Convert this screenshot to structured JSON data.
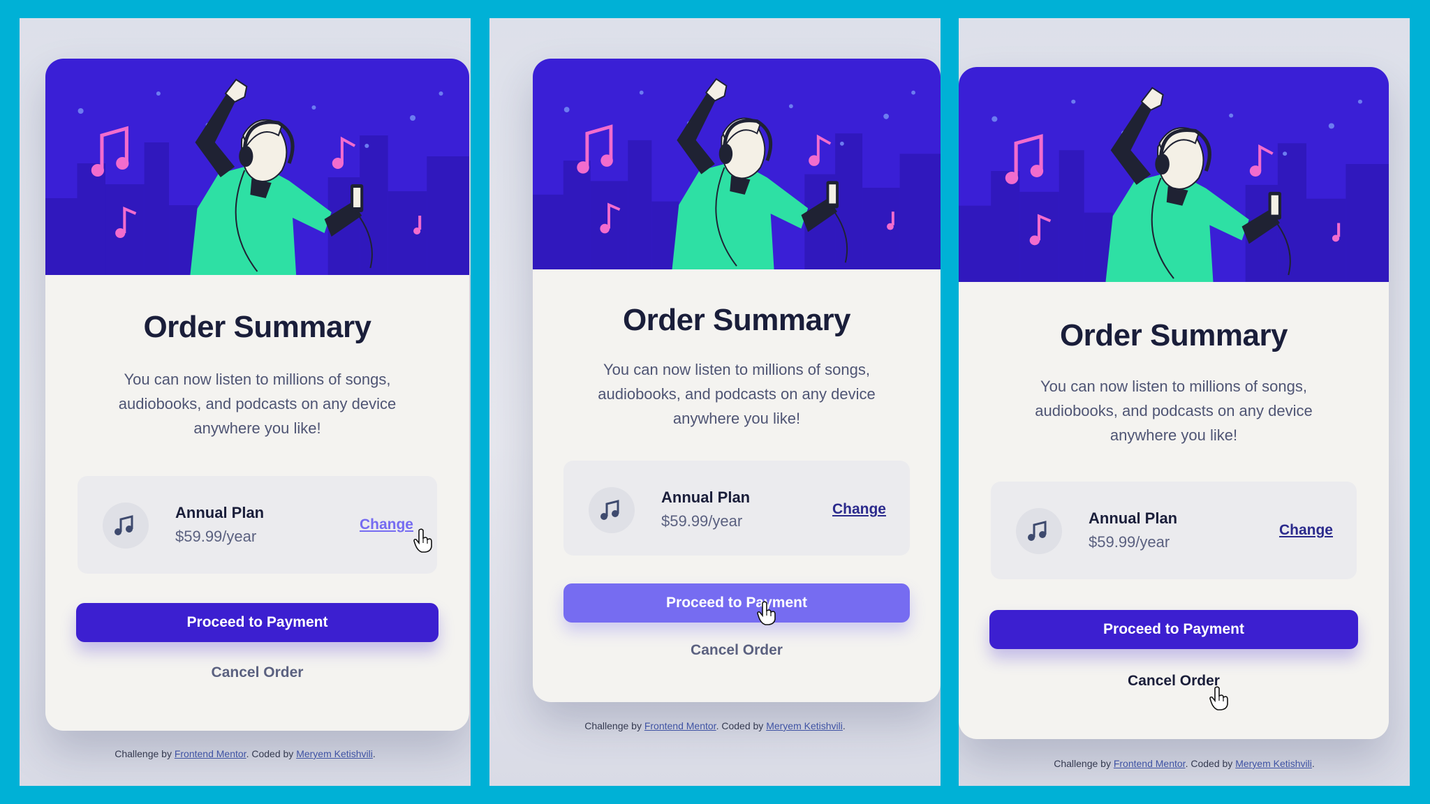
{
  "card": {
    "title": "Order Summary",
    "description": "You can now listen to millions of songs, audiobooks, and podcasts on any device anywhere you like!",
    "plan_name": "Annual Plan",
    "plan_price": "$59.99/year",
    "change_label": "Change",
    "proceed_label": "Proceed to Payment",
    "cancel_label": "Cancel Order"
  },
  "footer": {
    "challenge_text": "Challenge by",
    "frontend_mentor": "Frontend Mentor",
    "coded_text": ". Coded by",
    "author": "Meryem Ketishvili",
    "end": "."
  },
  "panels": [
    {
      "state": "change-hover"
    },
    {
      "state": "proceed-hover"
    },
    {
      "state": "cancel-hover"
    }
  ],
  "colors": {
    "frame": "#00b1d6",
    "hero_bg": "#3a1fd6",
    "primary": "#3c1fd0",
    "primary_hover": "#766cf1",
    "title": "#1a1e3a",
    "card_bg": "#f4f3f0"
  }
}
